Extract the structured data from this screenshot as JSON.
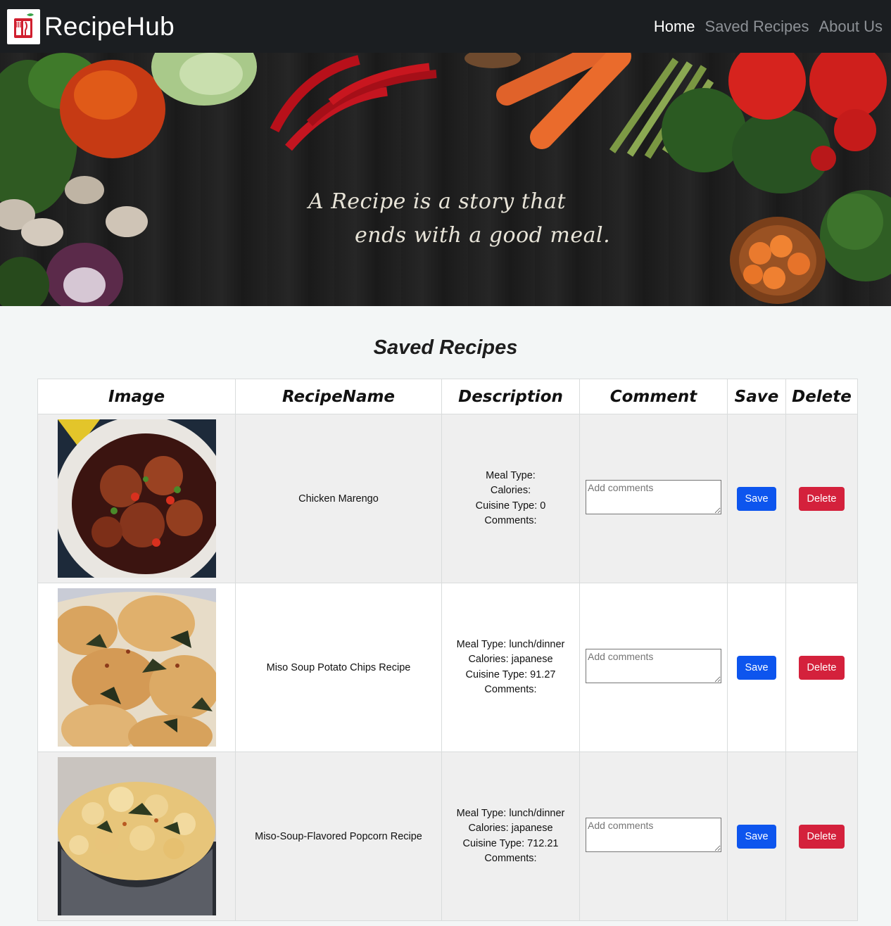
{
  "navbar": {
    "brand": "RecipeHub",
    "links": [
      {
        "label": "Home",
        "active": true
      },
      {
        "label": "Saved Recipes",
        "active": false
      },
      {
        "label": "About Us",
        "active": false
      }
    ]
  },
  "hero": {
    "quote_line1": "A Recipe is a story that",
    "quote_line2": "ends with a good meal."
  },
  "section": {
    "title": "Saved Recipes"
  },
  "table": {
    "headers": [
      "Image",
      "RecipeName",
      "Description",
      "Comment",
      "Save",
      "Delete"
    ],
    "rows": [
      {
        "name": "Chicken Marengo",
        "meal_type": "Meal Type:",
        "calories": "Calories:",
        "cuisine": "Cuisine Type: 0",
        "comments": "Comments:",
        "comment_placeholder": "Add comments",
        "save_label": "Save",
        "delete_label": "Delete"
      },
      {
        "name": "Miso Soup Potato Chips Recipe",
        "meal_type": "Meal Type: lunch/dinner",
        "calories": "Calories: japanese",
        "cuisine": "Cuisine Type: 91.27",
        "comments": "Comments:",
        "comment_placeholder": "Add comments",
        "save_label": "Save",
        "delete_label": "Delete"
      },
      {
        "name": "Miso-Soup-Flavored Popcorn Recipe",
        "meal_type": "Meal Type: lunch/dinner",
        "calories": "Calories: japanese",
        "cuisine": "Cuisine Type: 712.21",
        "comments": "Comments:",
        "comment_placeholder": "Add comments",
        "save_label": "Save",
        "delete_label": "Delete"
      }
    ]
  },
  "colors": {
    "navbar_bg": "#1b1e21",
    "save_button": "#0d55ee",
    "delete_button": "#d4213c",
    "page_bg": "#f3f6f6"
  }
}
